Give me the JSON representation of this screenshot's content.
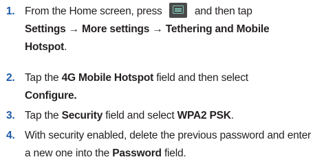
{
  "steps": [
    {
      "number": "1.",
      "text_a": "From the Home screen, press",
      "text_b": "and then tap",
      "bold_a": "Settings → More settings → Tethering and Mobile Hotspot",
      "text_c": "."
    },
    {
      "number": "2.",
      "text_a": "Tap the",
      "bold_a": "4G Mobile Hotspot",
      "text_b": "field and then select",
      "bold_b": "Configure."
    },
    {
      "number": "3.",
      "text_a": "Tap the",
      "bold_a": "Security",
      "text_b": "field and select",
      "bold_b": "WPA2 PSK",
      "text_c": "."
    },
    {
      "number": "4.",
      "text_a": "With security enabled, delete the previous password and enter a new one into the",
      "bold_a": "Password",
      "text_b": "field."
    }
  ],
  "icons": {
    "menu_key": "menu-key-icon"
  },
  "colors": {
    "step_number": "#1d5aa8",
    "menu_key_bg": "#4a4a4a",
    "menu_key_glyph": "#7fc4b5"
  }
}
